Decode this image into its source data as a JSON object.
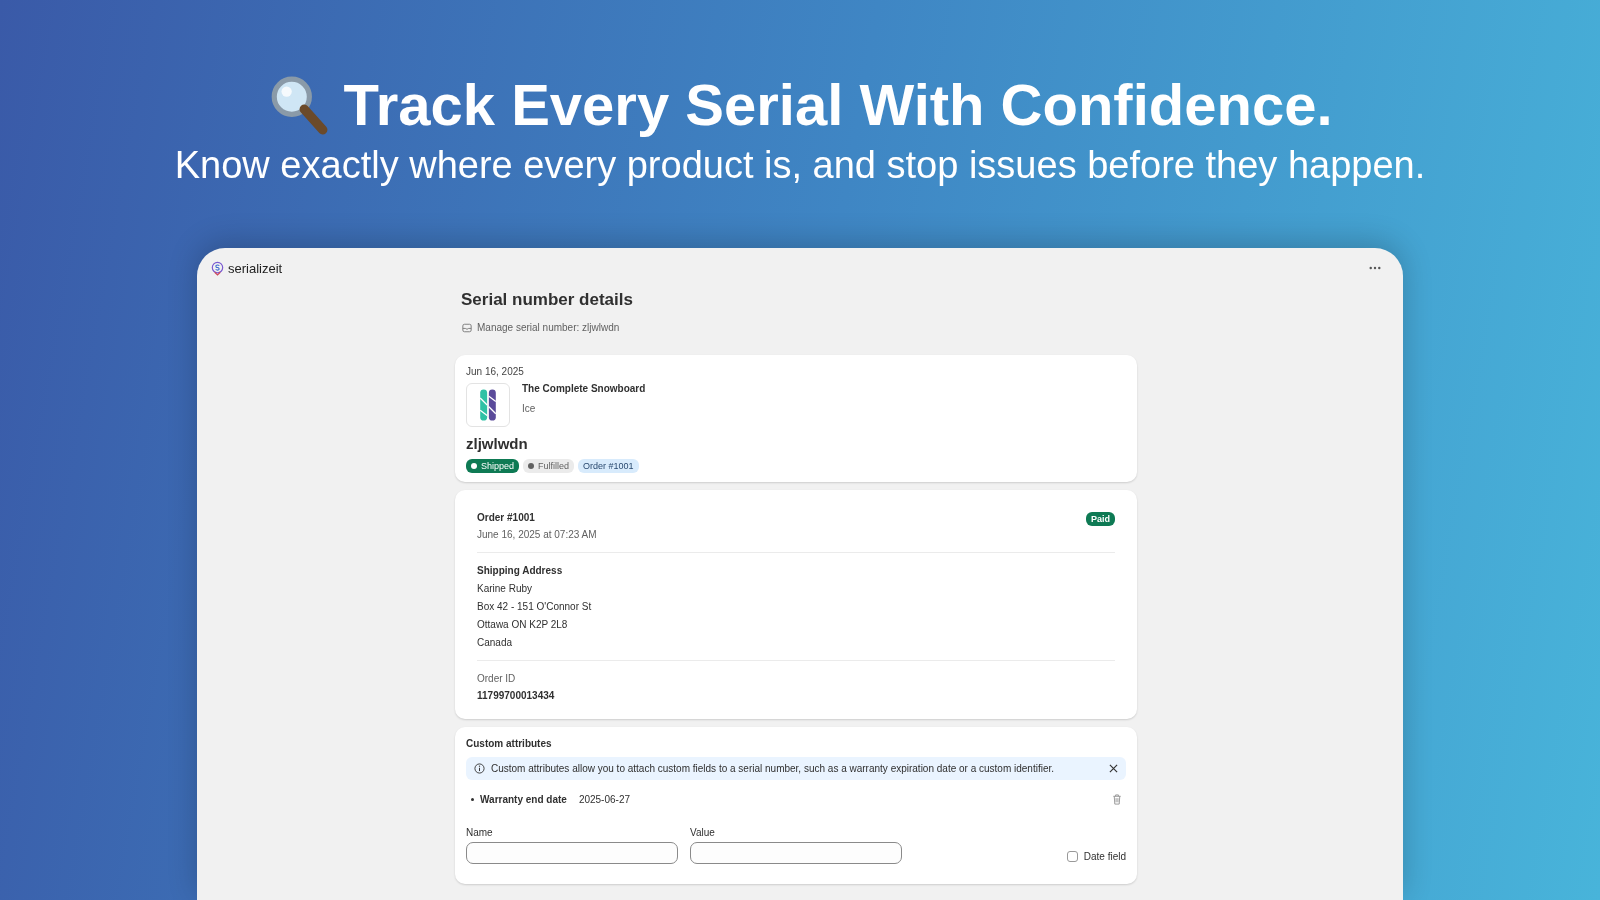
{
  "hero": {
    "headline": "Track Every Serial With Confidence.",
    "subheadline": "Know exactly where every product is, and stop issues before they happen."
  },
  "app": {
    "name": "serializeit"
  },
  "page": {
    "title": "Serial number details",
    "subtitle": "Manage serial number: zljwlwdn"
  },
  "serial_card": {
    "date": "Jun 16, 2025",
    "product": "The Complete Snowboard",
    "variant": "Ice",
    "serial": "zljwlwdn",
    "badges": [
      {
        "label": "Shipped",
        "kind": "success"
      },
      {
        "label": "Fulfilled",
        "kind": "neutral"
      },
      {
        "label": "Order #1001",
        "kind": "info"
      }
    ]
  },
  "order_card": {
    "title": "Order #1001",
    "date": "June 16, 2025 at 07:23 AM",
    "status": "Paid",
    "address_heading": "Shipping Address",
    "address_lines": [
      "Karine Ruby",
      "Box 42 - 151 O'Connor St",
      "Ottawa ON K2P 2L8",
      "Canada"
    ],
    "id_label": "Order ID",
    "id_value": "11799700013434"
  },
  "custom_attributes": {
    "title": "Custom attributes",
    "banner": "Custom attributes allow you to attach custom fields to a serial number, such as a warranty expiration date or a custom identifier.",
    "items": [
      {
        "name": "Warranty end date",
        "value": "2025-06-27"
      }
    ],
    "name_label": "Name",
    "value_label": "Value",
    "date_field": {
      "label": "Date field",
      "checked": false
    }
  }
}
